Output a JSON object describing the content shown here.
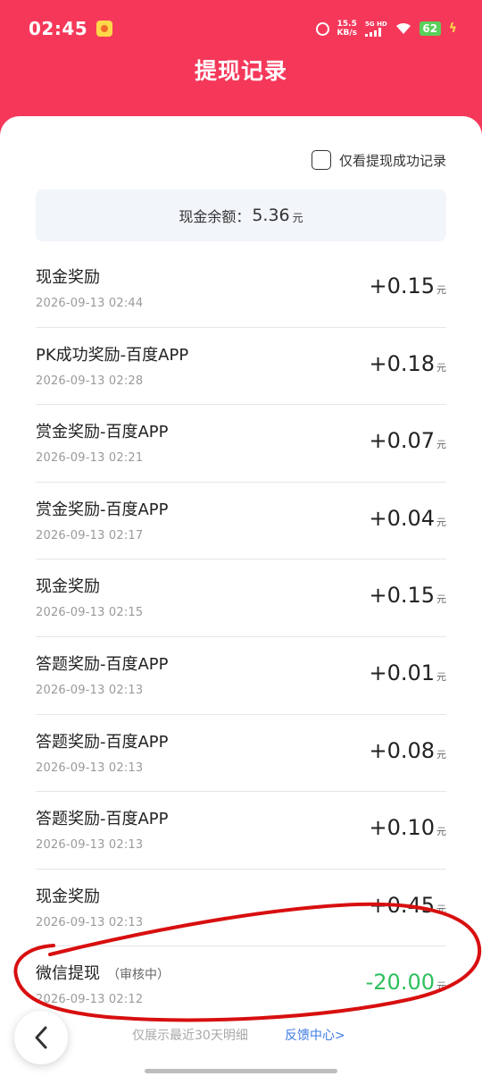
{
  "status_bar": {
    "time": "02:45",
    "speed_value": "15.5",
    "speed_unit": "KB/s",
    "network_top": "5G HD",
    "battery": "62"
  },
  "header": {
    "title": "提现记录"
  },
  "filter": {
    "label": "仅看提现成功记录",
    "checked": false
  },
  "balance": {
    "label": "现金余额：",
    "amount": "5.36",
    "unit": "元"
  },
  "records": [
    {
      "title": "现金奖励",
      "status": "",
      "time": "2026-09-13 02:44",
      "amount": "+0.15",
      "unit": "元"
    },
    {
      "title": "PK成功奖励-百度APP",
      "status": "",
      "time": "2026-09-13 02:28",
      "amount": "+0.18",
      "unit": "元"
    },
    {
      "title": "赏金奖励-百度APP",
      "status": "",
      "time": "2026-09-13 02:21",
      "amount": "+0.07",
      "unit": "元"
    },
    {
      "title": "赏金奖励-百度APP",
      "status": "",
      "time": "2026-09-13 02:17",
      "amount": "+0.04",
      "unit": "元"
    },
    {
      "title": "现金奖励",
      "status": "",
      "time": "2026-09-13 02:15",
      "amount": "+0.15",
      "unit": "元"
    },
    {
      "title": "答题奖励-百度APP",
      "status": "",
      "time": "2026-09-13 02:13",
      "amount": "+0.01",
      "unit": "元"
    },
    {
      "title": "答题奖励-百度APP",
      "status": "",
      "time": "2026-09-13 02:13",
      "amount": "+0.08",
      "unit": "元"
    },
    {
      "title": "答题奖励-百度APP",
      "status": "",
      "time": "2026-09-13 02:13",
      "amount": "+0.10",
      "unit": "元"
    },
    {
      "title": "现金奖励",
      "status": "",
      "time": "2026-09-13 02:13",
      "amount": "+0.45",
      "unit": "元"
    },
    {
      "title": "微信提现",
      "status": "（审核中）",
      "time": "2026-09-13 02:12",
      "amount": "-20.00",
      "unit": "元"
    }
  ],
  "footer": {
    "note": "仅展示最近30天明细",
    "feedback": "反馈中心>"
  },
  "colors": {
    "header_bg": "#f5385a",
    "positive_amount": "#222222",
    "withdraw_amount": "#2fbf5f",
    "link": "#3f7be6",
    "annotation": "#d80f0f"
  },
  "icons": {
    "back": "chevron-left-icon",
    "checkbox": "checkbox-icon",
    "alarm": "alarm-icon",
    "wifi": "wifi-icon"
  }
}
